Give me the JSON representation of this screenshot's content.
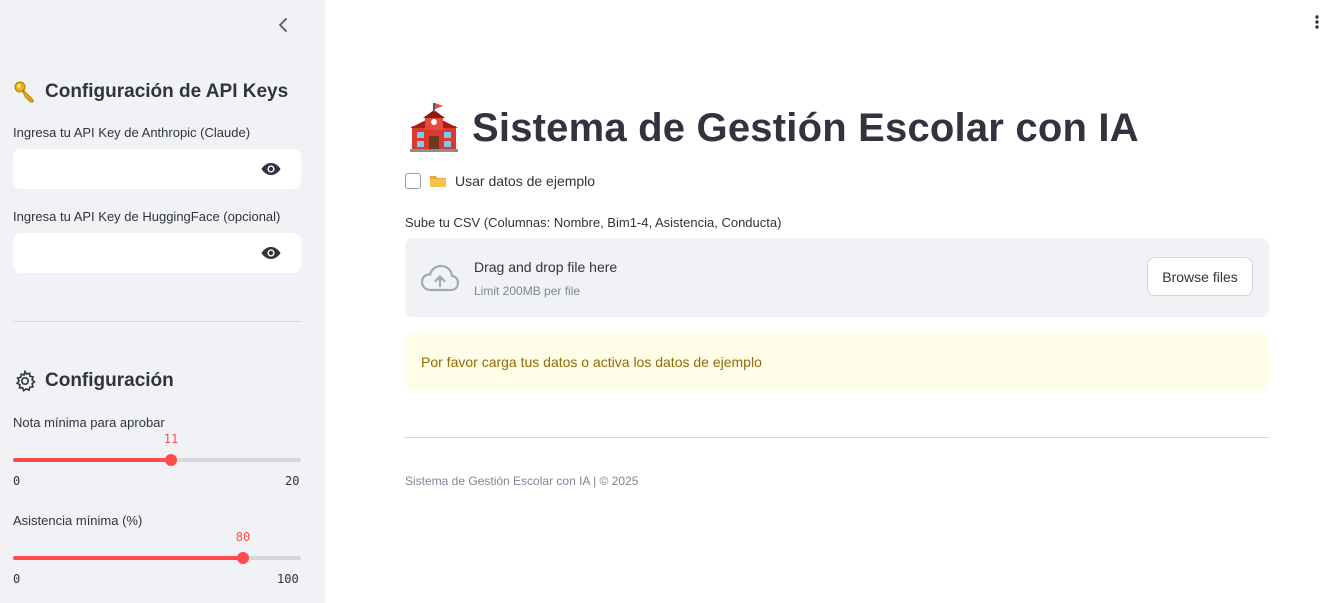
{
  "sidebar": {
    "api_section": {
      "title": "Configuración de API Keys",
      "icon": "key-icon",
      "anthropic_label": "Ingresa tu API Key de Anthropic (Claude)",
      "anthropic_value": "",
      "huggingface_label": "Ingresa tu API Key de HuggingFace (opcional)",
      "huggingface_value": ""
    },
    "config_section": {
      "title": "Configuración",
      "icon": "gear-icon",
      "nota_label": "Nota mínima para aprobar",
      "nota_value": "11",
      "nota_min": "0",
      "nota_max": "20",
      "asistencia_label": "Asistencia mínima (%)",
      "asistencia_value": "80",
      "asistencia_min": "0",
      "asistencia_max": "100"
    }
  },
  "main": {
    "title": "Sistema de Gestión Escolar con IA",
    "title_icon": "school-icon",
    "sample_checkbox_label": "Usar datos de ejemplo",
    "sample_checkbox_checked": false,
    "upload_label": "Sube tu CSV (Columnas: Nombre, Bim1-4, Asistencia, Conducta)",
    "dropzone_title": "Drag and drop file here",
    "dropzone_limit": "Limit 200MB per file",
    "browse_button": "Browse files",
    "warning_text": "Por favor carga tus datos o activa los datos de ejemplo",
    "footer_text": "Sistema de Gestión Escolar con IA | © 2025"
  },
  "colors": {
    "accent": "#ff4b4b",
    "sidebar_bg": "#f0f2f6",
    "warning_bg": "#fffce7",
    "warning_text": "#926c05"
  }
}
